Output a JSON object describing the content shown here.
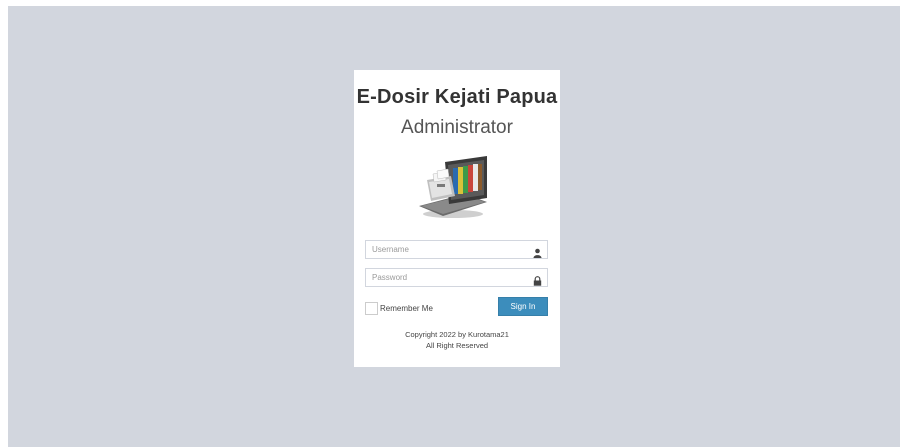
{
  "app": {
    "title": "E-Dosir Kejati Papua",
    "subtitle": "Administrator",
    "logo_icon": "file-cabinet-laptop-icon"
  },
  "form": {
    "username_placeholder": "Username",
    "username_icon": "user-icon",
    "password_placeholder": "Password",
    "password_icon": "lock-icon",
    "remember_label": "Remember Me",
    "remember_checked": false,
    "signin_label": "Sign In"
  },
  "footer": {
    "copyright": "Copyright 2022 by Kurotama21",
    "rights": "All Right Reserved"
  },
  "colors": {
    "background": "#d2d6de",
    "card": "#ffffff",
    "primary_button": "#3c8dbc"
  }
}
